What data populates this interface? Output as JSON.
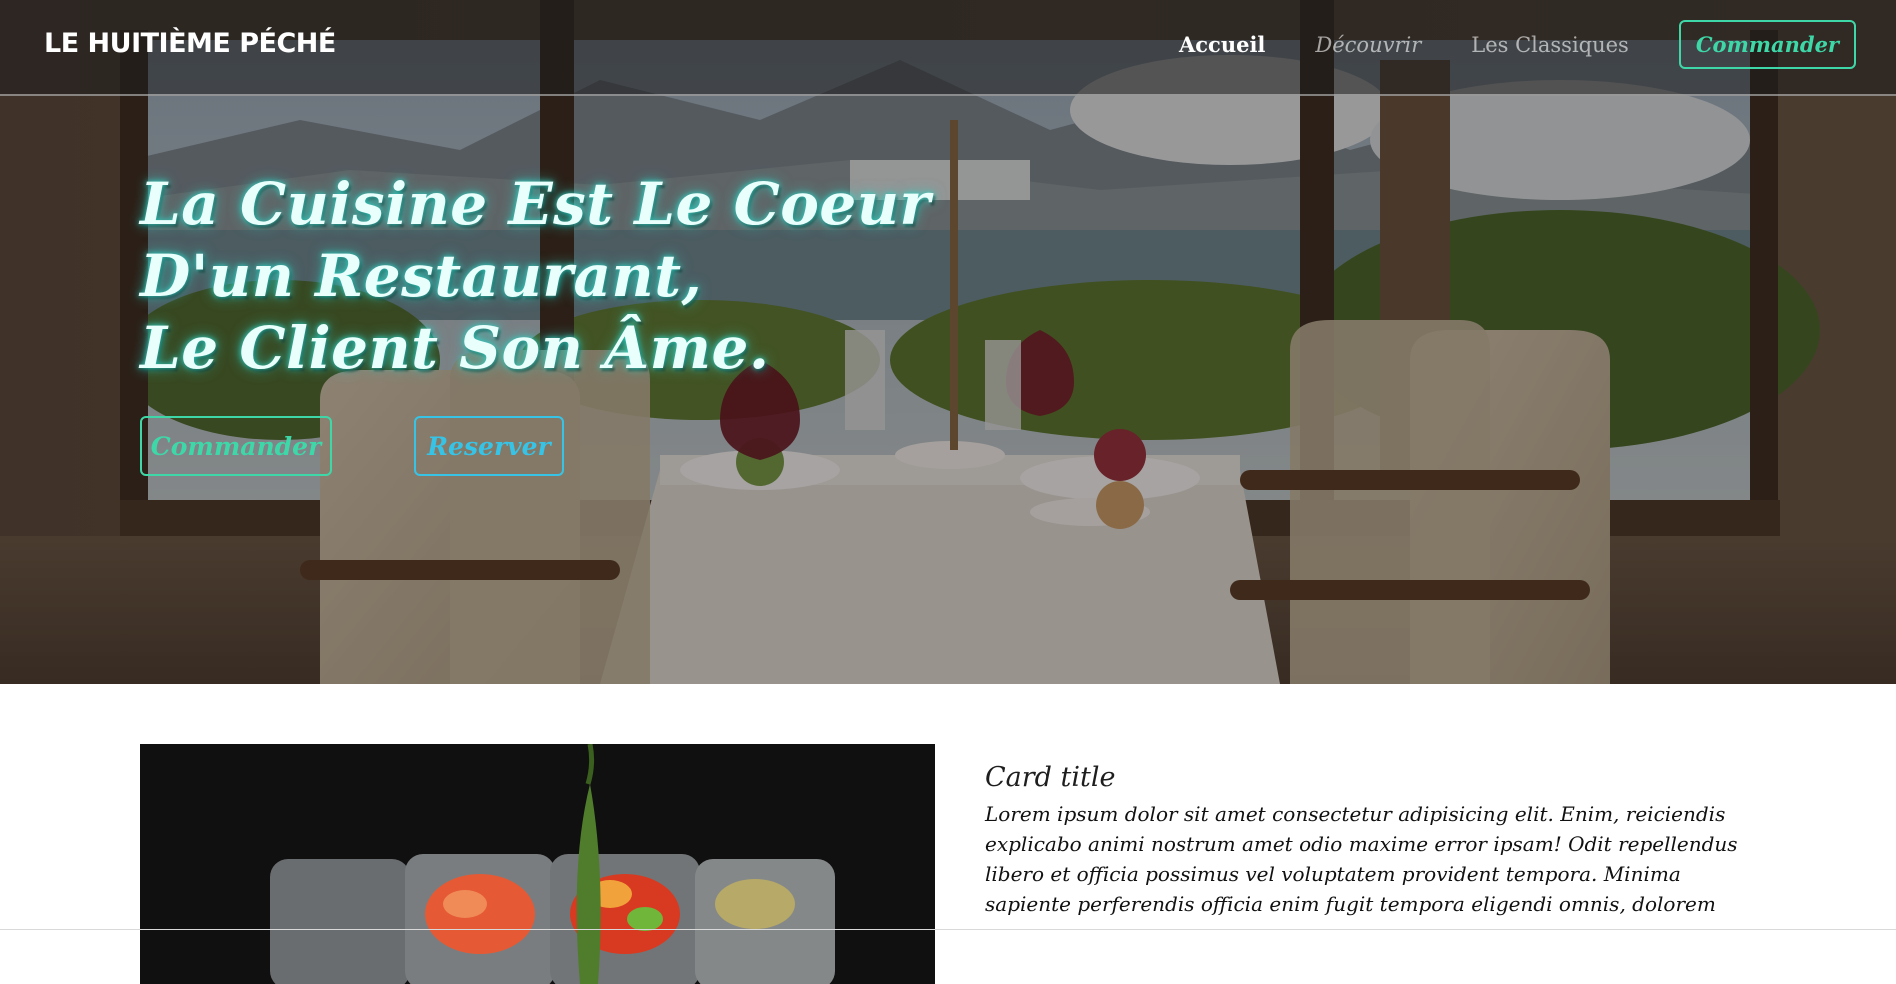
{
  "brand": {
    "name": "LE HUITIÈME PÉCHÉ"
  },
  "nav": {
    "items": [
      {
        "label": "Accueil"
      },
      {
        "label": "Découvrir"
      },
      {
        "label": "Les Classiques"
      }
    ],
    "cta_label": "Commander"
  },
  "hero": {
    "headline_lines": [
      "La Cuisine Est Le Coeur",
      "D'un Restaurant,",
      "Le Client Son Âme."
    ],
    "order_label": "Commander",
    "book_label": "Reserver"
  },
  "card": {
    "title": "Card title",
    "text": "Lorem ipsum dolor sit amet consectetur adipisicing elit. Enim, reiciendis explicabo animi nostrum amet odio maxime error ipsam! Odit repellendus libero et officia possimus vel voluptatem provident tempora. Minima sapiente perferendis officia enim fugit tempora eligendi omnis, dolorem"
  },
  "colors": {
    "accent_green": "#3ed7a7",
    "accent_cyan": "#37c3e6",
    "headline_glow": "#2fd3c4",
    "navbar_bg": "rgba(30,30,30,0.55)"
  },
  "icons": {
    "hero_image": "restaurant-table-by-window-photo",
    "card_image": "plated-salmon-dish-photo"
  }
}
